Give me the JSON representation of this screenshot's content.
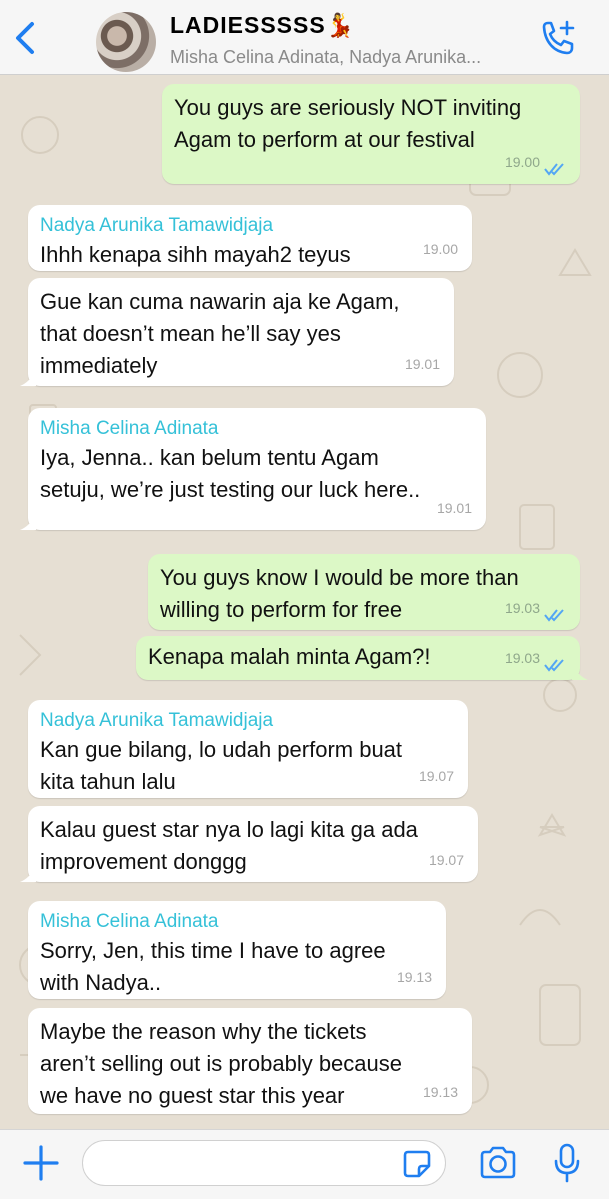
{
  "header": {
    "title": "LADIESSSSS",
    "title_emoji": "💃",
    "subtitle": "Misha Celina Adinata, Nadya Arunika...",
    "icons": {
      "back": "chevron-left-icon",
      "call": "add-call-icon",
      "avatar": "group-avatar"
    }
  },
  "colors": {
    "accent": "#1f7ef0",
    "outgoing_bubble": "#dcf8c6",
    "incoming_bubble": "#ffffff",
    "sender_name": "#35c1d8",
    "read_ticks": "#53a6f4"
  },
  "messages": [
    {
      "direction": "out",
      "text": "You guys are seriously NOT inviting\nAgam to perform at our festival",
      "time": "19.00",
      "ticks": "double-check-icon"
    },
    {
      "direction": "in",
      "sender": "Nadya Arunika Tamawidjaja",
      "text": "Ihhh kenapa sihh mayah2 teyus",
      "time": "19.00"
    },
    {
      "direction": "in",
      "text": "Gue kan cuma nawarin aja ke Agam,\nthat doesn’t mean he’ll say yes\nimmediately",
      "time": "19.01"
    },
    {
      "direction": "in",
      "sender": "Misha Celina Adinata",
      "text": "Iya, Jenna.. kan belum tentu Agam\nsetuju, we’re just testing our luck here..",
      "time": "19.01"
    },
    {
      "direction": "out",
      "text": "You guys know I would be more than\nwilling to perform for free",
      "time": "19.03",
      "ticks": "double-check-icon"
    },
    {
      "direction": "out",
      "text": "Kenapa malah minta Agam?!",
      "time": "19.03",
      "ticks": "double-check-icon"
    },
    {
      "direction": "in",
      "sender": "Nadya Arunika Tamawidjaja",
      "text": "Kan gue bilang, lo udah perform buat\nkita tahun lalu",
      "time": "19.07"
    },
    {
      "direction": "in",
      "text": "Kalau guest star nya lo lagi kita ga ada\nimprovement donggg",
      "time": "19.07"
    },
    {
      "direction": "in",
      "sender": "Misha Celina Adinata",
      "text": "Sorry, Jen, this time I have to agree\nwith Nadya..",
      "time": "19.13"
    },
    {
      "direction": "in",
      "text": "Maybe the reason why the tickets\naren’t selling out is probably because\nwe have no guest star this year",
      "time": "19.13"
    }
  ],
  "footer": {
    "input_value": "",
    "input_placeholder": "",
    "icons": {
      "add": "plus-icon",
      "sticker": "sticker-icon",
      "camera": "camera-icon",
      "mic": "microphone-icon"
    }
  }
}
